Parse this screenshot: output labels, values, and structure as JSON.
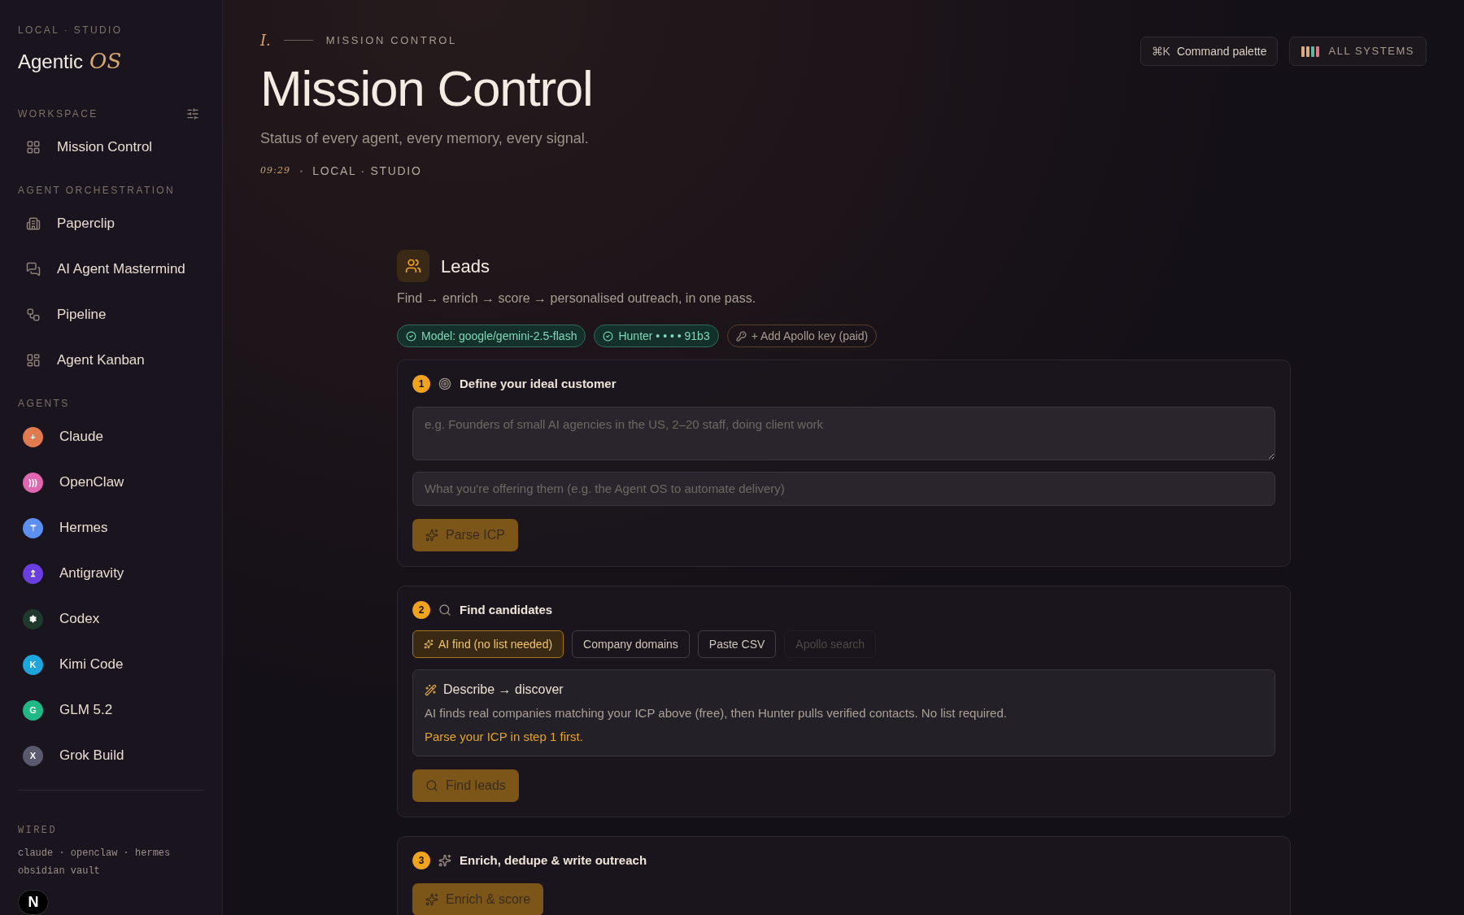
{
  "sidebar": {
    "eyebrow": "LOCAL · STUDIO",
    "brand": "Agentic",
    "brand_accent": "OS",
    "sections": [
      {
        "title": "WORKSPACE",
        "items": [
          {
            "kind": "nav",
            "label": "Mission Control"
          }
        ]
      },
      {
        "title": "AGENT ORCHESTRATION",
        "items": [
          {
            "kind": "nav",
            "label": "Paperclip"
          },
          {
            "kind": "nav",
            "label": "AI Agent Mastermind"
          },
          {
            "kind": "nav",
            "label": "Pipeline"
          },
          {
            "kind": "nav",
            "label": "Agent Kanban"
          }
        ]
      },
      {
        "title": "AGENTS",
        "items": [
          {
            "kind": "agent",
            "label": "Claude",
            "glyph": "+",
            "color": "#e07a4f"
          },
          {
            "kind": "agent",
            "label": "OpenClaw",
            "glyph": ")))",
            "color": "#e066b0"
          },
          {
            "kind": "agent",
            "label": "Hermes",
            "glyph": "⚚",
            "color": "#5b8ff0"
          },
          {
            "kind": "agent",
            "label": "Antigravity",
            "glyph": "↥",
            "color": "#6a3ee0"
          },
          {
            "kind": "agent",
            "label": "Codex",
            "glyph": "❃",
            "color": "#1f3a2c"
          },
          {
            "kind": "agent",
            "label": "Kimi Code",
            "glyph": "K",
            "color": "#1ca6dc"
          },
          {
            "kind": "agent",
            "label": "GLM 5.2",
            "glyph": "G",
            "color": "#20b884"
          },
          {
            "kind": "agent",
            "label": "Grok Build",
            "glyph": "X",
            "color": "#5a5a6e"
          }
        ]
      }
    ],
    "wired": {
      "title": "WIRED",
      "lines": [
        "claude · openclaw · hermes",
        "obsidian vault"
      ]
    },
    "dev_badge": "N"
  },
  "header": {
    "index": "I.",
    "eyebrow": "MISSION CONTROL",
    "title": "Mission Control",
    "subtitle": "Status of every agent, every memory, every signal.",
    "time": "09:29",
    "location": "LOCAL · STUDIO",
    "command_palette": {
      "shortcut": "⌘K",
      "label": "Command palette"
    },
    "systems": {
      "label": "ALL SYSTEMS",
      "bars": [
        {
          "color": "#d9ab7e"
        },
        {
          "color": "#d9ab7e"
        },
        {
          "color": "#5fb8a2"
        },
        {
          "color": "#d77a8c"
        }
      ]
    }
  },
  "leads": {
    "title": "Leads",
    "description": "Find → enrich → score → personalised outreach, in one pass.",
    "chips": [
      {
        "kind": "ok",
        "label": "Model: google/gemini-2.5-flash"
      },
      {
        "kind": "ok",
        "label": "Hunter • • • • 91b3"
      },
      {
        "kind": "action",
        "label": "+ Add Apollo key (paid)"
      }
    ],
    "steps": [
      {
        "number": "1",
        "title": "Define your ideal customer",
        "fields": [
          {
            "kind": "textarea",
            "placeholder": "e.g. Founders of small AI agencies in the US, 2–20 staff, doing client work"
          },
          {
            "kind": "input",
            "placeholder": "What you're offering them (e.g. the Agent OS to automate delivery)"
          }
        ],
        "button": "Parse ICP"
      },
      {
        "number": "2",
        "title": "Find candidates",
        "tabs": [
          {
            "label": "AI find (no list needed)",
            "selected": true,
            "disabled": false
          },
          {
            "label": "Company domains",
            "selected": false,
            "disabled": false
          },
          {
            "label": "Paste CSV",
            "selected": false,
            "disabled": false
          },
          {
            "label": "Apollo search",
            "selected": false,
            "disabled": true
          }
        ],
        "info": {
          "title": "Describe → discover",
          "text": "AI finds real companies matching your ICP above (free), then Hunter pulls verified contacts. No list required.",
          "warning": "Parse your ICP in step 1 first."
        },
        "button": "Find leads"
      },
      {
        "number": "3",
        "title": "Enrich, dedupe & write outreach",
        "button": "Enrich & score"
      }
    ]
  }
}
